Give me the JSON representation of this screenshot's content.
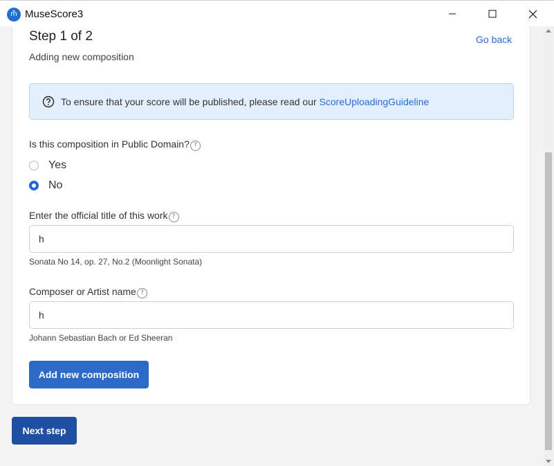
{
  "window": {
    "app_icon": "musescore-logo-icon",
    "app_icon_glyph": "m̊",
    "title": "MuseScore3",
    "controls": [
      "minimize-icon",
      "maximize-icon",
      "close-icon"
    ]
  },
  "header": {
    "step_title": "Step 1 of 2",
    "subtitle": "Adding new composition",
    "go_back": "Go back"
  },
  "notice": {
    "icon": "question-circle-icon",
    "text": "To ensure that your score will be published, please read our",
    "link": "ScoreUploadingGuideline"
  },
  "public_domain": {
    "label": "Is this composition in Public Domain?",
    "help_glyph": "?",
    "options": [
      {
        "label": "Yes",
        "checked": false
      },
      {
        "label": "No",
        "checked": true
      }
    ]
  },
  "title_field": {
    "label": "Enter the official title of this work",
    "help_glyph": "?",
    "value": "h",
    "hint": "Sonata No 14, op. 27, No.2 (Moonlight Sonata)"
  },
  "composer_field": {
    "label": "Composer or Artist name",
    "help_glyph": "?",
    "value": "h",
    "hint": "Johann Sebastian Bach or Ed Sheeran"
  },
  "actions": {
    "add_composition": "Add new composition",
    "next_step": "Next step"
  },
  "colors": {
    "accent": "#2c6ac9",
    "next_button": "#1f4fa3",
    "link": "#2a6ad3",
    "notice_bg": "#e3effd"
  }
}
